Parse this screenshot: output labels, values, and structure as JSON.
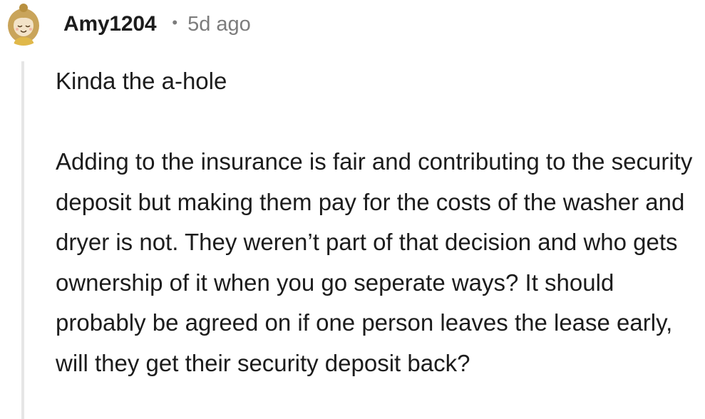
{
  "comment": {
    "author": "Amy1204",
    "separator": "•",
    "timestamp": "5d ago",
    "avatar_icon": "cartoon-girl-avatar-icon",
    "body": {
      "paragraph1": "Kinda the a-hole",
      "paragraph2": "Adding to the insurance is fair and contributing to the security deposit but making them pay for the costs of the washer and dryer is not. They weren’t part of that decision and who gets ownership of it when you go seperate ways? It should probably be agreed on if one person leaves the lease early, will they get their security deposit back?"
    }
  },
  "colors": {
    "text": "#1c1c1c",
    "meta": "#7c7c7c",
    "thread_line": "#e6e6e6",
    "avatar_hair": "#c9a45a",
    "avatar_face": "#f3e3c8"
  }
}
